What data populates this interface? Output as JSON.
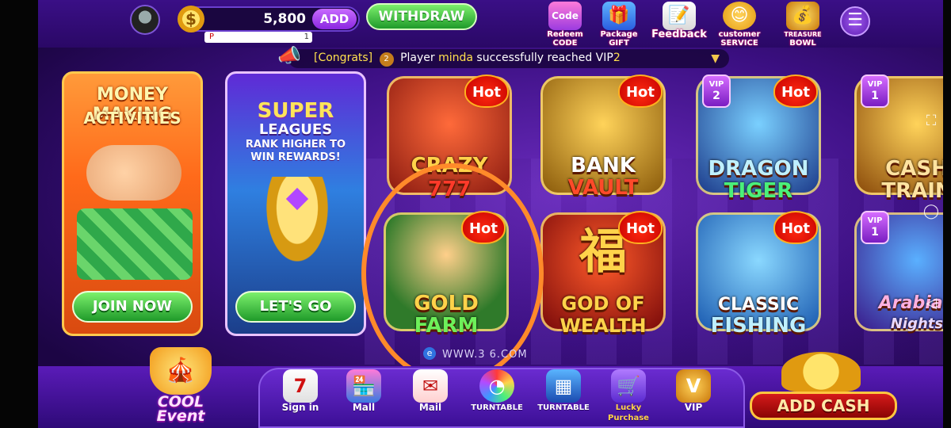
{
  "colors": {
    "accent": "#3b0f82",
    "withdraw": "#1f9a2a",
    "hot": "#e01414",
    "ring": "#ff8a2a"
  },
  "header": {
    "balance": "5,800",
    "add_label": "ADD",
    "sub_label": "P",
    "sub_count": "1",
    "withdraw_label": "WITHDRAW",
    "icons": [
      {
        "name": "redeem-code",
        "line1": "Redeem",
        "line2": "CODE",
        "glyph": "Code"
      },
      {
        "name": "package-gift",
        "line1": "Package",
        "line2": "GIFT",
        "glyph": "🎁"
      },
      {
        "name": "feedback",
        "line1": "Feedback",
        "line2": "",
        "glyph": "📝"
      },
      {
        "name": "customer-service",
        "line1": "customer",
        "line2": "SERVICE",
        "glyph": "😊"
      },
      {
        "name": "treasure-bowl",
        "line1": "TREASURE",
        "line2": "BOWL",
        "glyph": "💰"
      }
    ]
  },
  "notice": {
    "tag": "[Congrats]",
    "vip_number": "2",
    "prefix": "Player",
    "player": "minda",
    "message": "successfully reached VIP",
    "level": "2"
  },
  "promos": [
    {
      "line1": "MONEY MAKING",
      "line2": "ACTIVITIES",
      "button": "JOIN NOW"
    },
    {
      "line1": "SUPER",
      "line2": "LEAGUES",
      "line3": "RANK HIGHER TO",
      "line4": "WIN REWARDS!",
      "button": "LET'S GO"
    }
  ],
  "games": {
    "crazy777": {
      "line1": "CRAZY",
      "line2": "777",
      "hot": "Hot"
    },
    "bank_vault": {
      "line1": "BANK",
      "line2": "VAULT",
      "hot": "Hot"
    },
    "dragon_tiger": {
      "line1": "DRAGON",
      "line2": "TIGER",
      "hot": "Hot",
      "vip_label": "VIP",
      "vip_level": "2"
    },
    "cash_train": {
      "line1": "CASH",
      "line2": "TRAIN",
      "vip_label": "VIP",
      "vip_level": "1"
    },
    "gold_farm": {
      "line1": "GOLD",
      "line2": "FARM",
      "hot": "Hot"
    },
    "god_of_wealth": {
      "glyph": "福",
      "line1": "GOD OF",
      "line2": "WEALTH",
      "hot": "Hot"
    },
    "classic_fishing": {
      "line1": "CLASSIC",
      "line2": "FISHING",
      "hot": "Hot"
    },
    "arabian_nights": {
      "line1": "Arabian",
      "line2": "Nights",
      "vip_label": "VIP",
      "vip_level": "1"
    }
  },
  "watermark": "WWW.3 6.COM",
  "bottom_nav": {
    "event": {
      "line1": "COOL",
      "line2": "Event"
    },
    "items": [
      {
        "label": "Sign in",
        "glyph": "7"
      },
      {
        "label": "Mall",
        "glyph": "🏪"
      },
      {
        "label": "Mail",
        "glyph": "✉"
      },
      {
        "label": "TURNTABLE",
        "glyph": "◔"
      },
      {
        "label": "TURNTABLE",
        "glyph": "▦"
      },
      {
        "label": "Lucky Purchase",
        "glyph": "🛒"
      },
      {
        "label": "VIP",
        "glyph": "V"
      }
    ],
    "add_cash": "ADD CASH"
  }
}
